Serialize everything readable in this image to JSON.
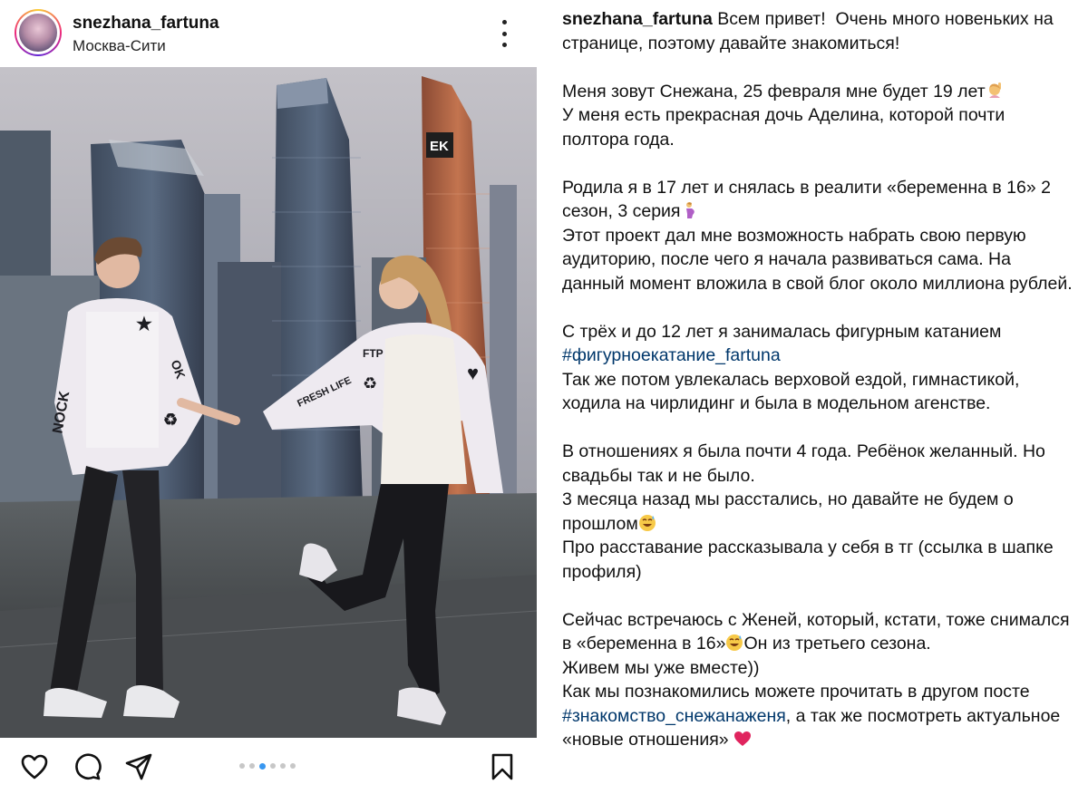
{
  "post": {
    "username": "snezhana_fartuna",
    "location": "Москва-Сити",
    "carousel": {
      "count": 6,
      "active_index": 2
    }
  },
  "caption": {
    "username": "snezhana_fartuna",
    "p1_text": " Всем привет!  Очень много новеньких на странице, поэтому давайте знакомиться!",
    "p2_line1": "Меня зовут Снежана, 25 февраля мне будет 19 лет",
    "p2_line2": "У меня есть прекрасная дочь Аделина, которой почти полтора года.",
    "p3_line1": "Родила я в 17 лет и снялась в реалити «беременна в 16» 2 сезон, 3 серия",
    "p3_line2": "Этот проект дал мне возможность набрать свою первую аудиторию, после чего я начала развиваться сама. На данный момент вложила в свой блог около миллиона рублей.",
    "p4_line1": "С трёх и до 12 лет я занималась фигурным катанием",
    "p4_hashtag": "#фигурноекатание_fartuna",
    "p4_line2": "Так же потом увлекалась верховой ездой, гимнастикой, ходила на чирлидинг и была в модельном агенстве.",
    "p5_line1": "В отношениях я была почти 4 года. Ребёнок желанный. Но свадьбы так и не было.",
    "p5_line2": "3 месяца назад мы расстались, но давайте не будем о прошлом",
    "p5_line3": "Про расставание рассказывала у себя в тг (ссылка в шапке профиля)",
    "p6_line1": "Сейчас встречаюсь с Женей, который, кстати, тоже снимался в «беременна в 16»",
    "p6_line1b": "Он из третьего сезона.",
    "p6_line2": "Живем мы уже вместе))",
    "p6_line3": "Как мы познакомились можете прочитать в другом посте",
    "p6_hashtag": "#знакомство_снежанаженя",
    "p6_line3b": ", а так же посмотреть актуальное «новые отношения»"
  },
  "icons": {
    "more": "more-options-icon",
    "like": "heart-outline-icon",
    "comment": "comment-bubble-icon",
    "share": "paper-plane-icon",
    "save": "bookmark-icon",
    "emoji_hand": "raising-hand-emoji-icon",
    "emoji_pregnant": "pregnant-woman-emoji-icon",
    "emoji_sweat": "sweat-smile-emoji-icon",
    "emoji_heart": "red-heart-emoji-icon"
  },
  "colors": {
    "hashtag": "#00376b",
    "carousel_active": "#3897f0",
    "carousel_inactive": "#c7c7c7",
    "heart": "#e0245e"
  }
}
